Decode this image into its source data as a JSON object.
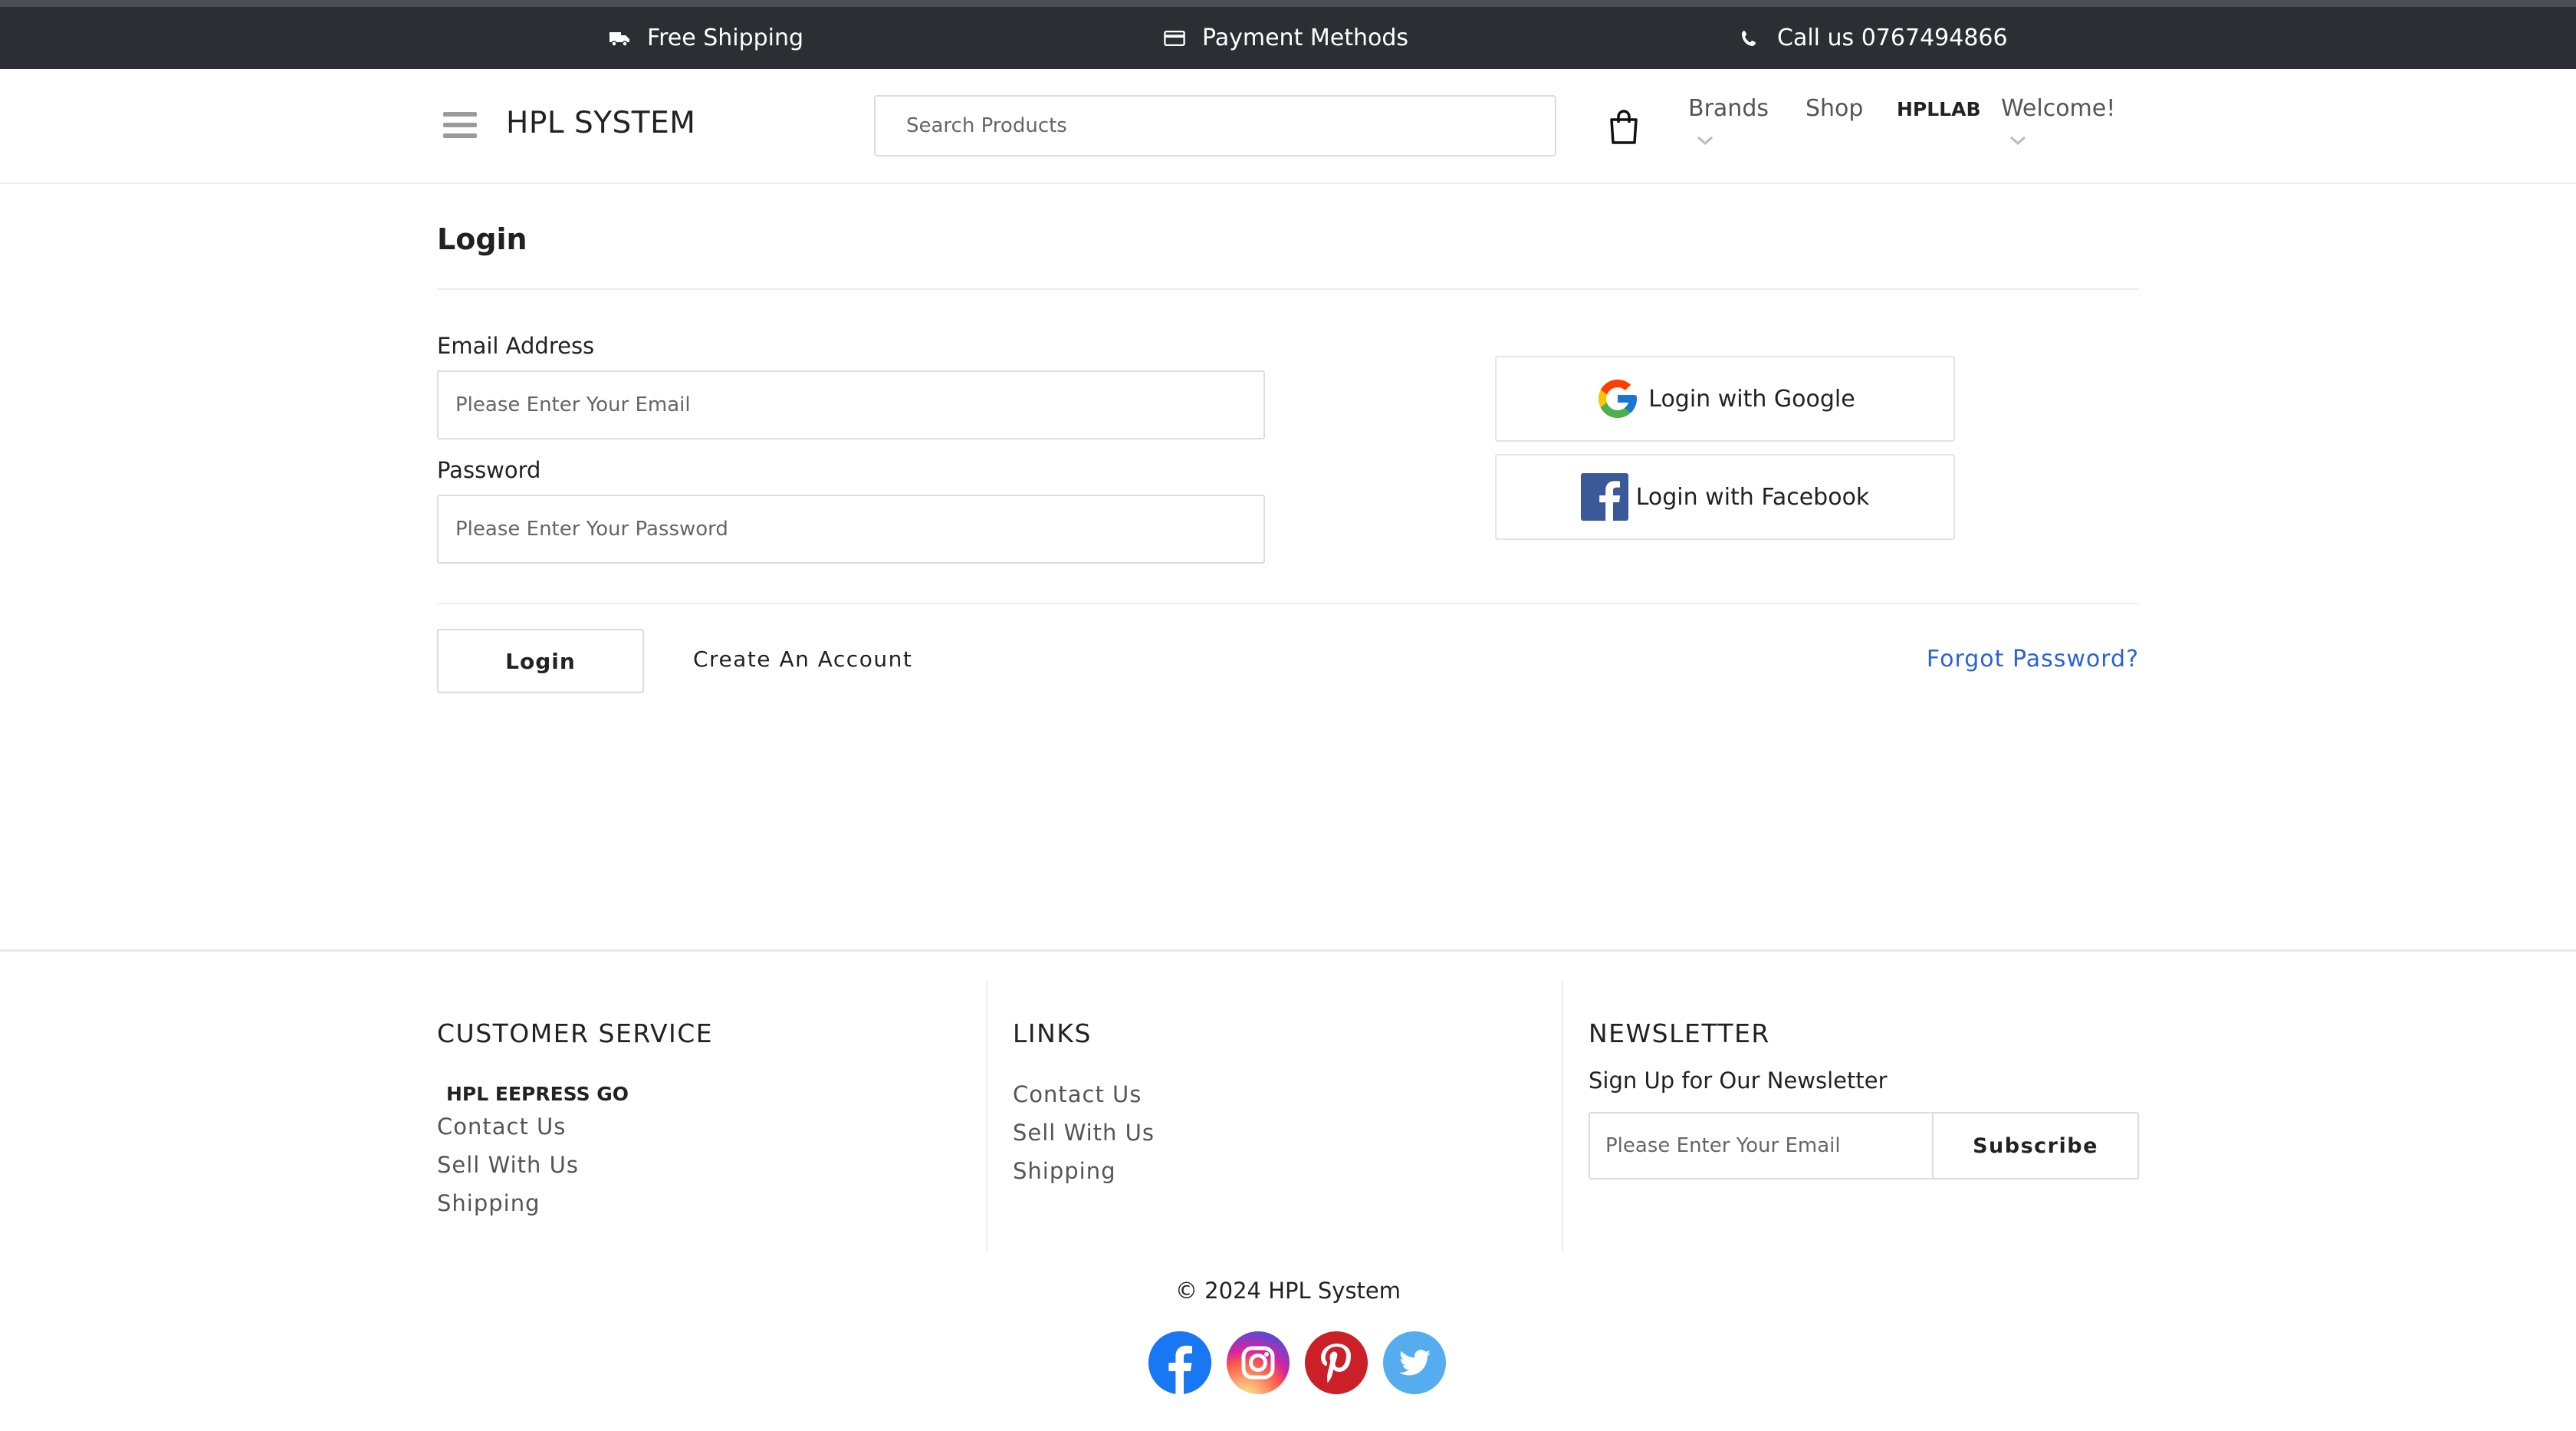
{
  "topbar": {
    "shipping": "Free Shipping",
    "payment": "Payment Methods",
    "call": "Call us 0767494866",
    "icons": [
      "truck-icon",
      "credit-card-icon",
      "phone-icon"
    ]
  },
  "header": {
    "brand": "HPL SYSTEM",
    "search_placeholder": "Search Products",
    "nav": {
      "brands": "Brands",
      "shop": "Shop",
      "hpllab": "HPLLAB",
      "welcome": "Welcome!"
    }
  },
  "login": {
    "title": "Login",
    "email_label": "Email Address",
    "email_placeholder": "Please Enter Your Email",
    "password_label": "Password",
    "password_placeholder": "Please Enter Your Password",
    "google_label": "Login with Google",
    "facebook_label": "Login with Facebook",
    "login_button": "Login",
    "create_account": "Create An Account",
    "forgot_password": "Forgot Password?"
  },
  "footer": {
    "customer_service": {
      "heading": "CUSTOMER SERVICE",
      "sub": "HPL EEPRESS GO",
      "links": [
        "Contact Us",
        "Sell With Us",
        "Shipping"
      ]
    },
    "links": {
      "heading": "LINKS",
      "links": [
        "Contact Us",
        "Sell With Us",
        "Shipping"
      ]
    },
    "newsletter": {
      "heading": "NEWSLETTER",
      "text": "Sign Up for Our Newsletter",
      "placeholder": "Please Enter Your Email",
      "button": "Subscribe"
    },
    "copyright": "© 2024 HPL System",
    "social": [
      "facebook-icon",
      "instagram-icon",
      "pinterest-icon",
      "twitter-icon"
    ]
  },
  "colors": {
    "topbar_bg": "#2b2e33",
    "link_blue": "#2a62d8",
    "facebook_blue": "#3b5998",
    "twitter_blue": "#55acee",
    "pinterest_red": "#cb2027"
  }
}
